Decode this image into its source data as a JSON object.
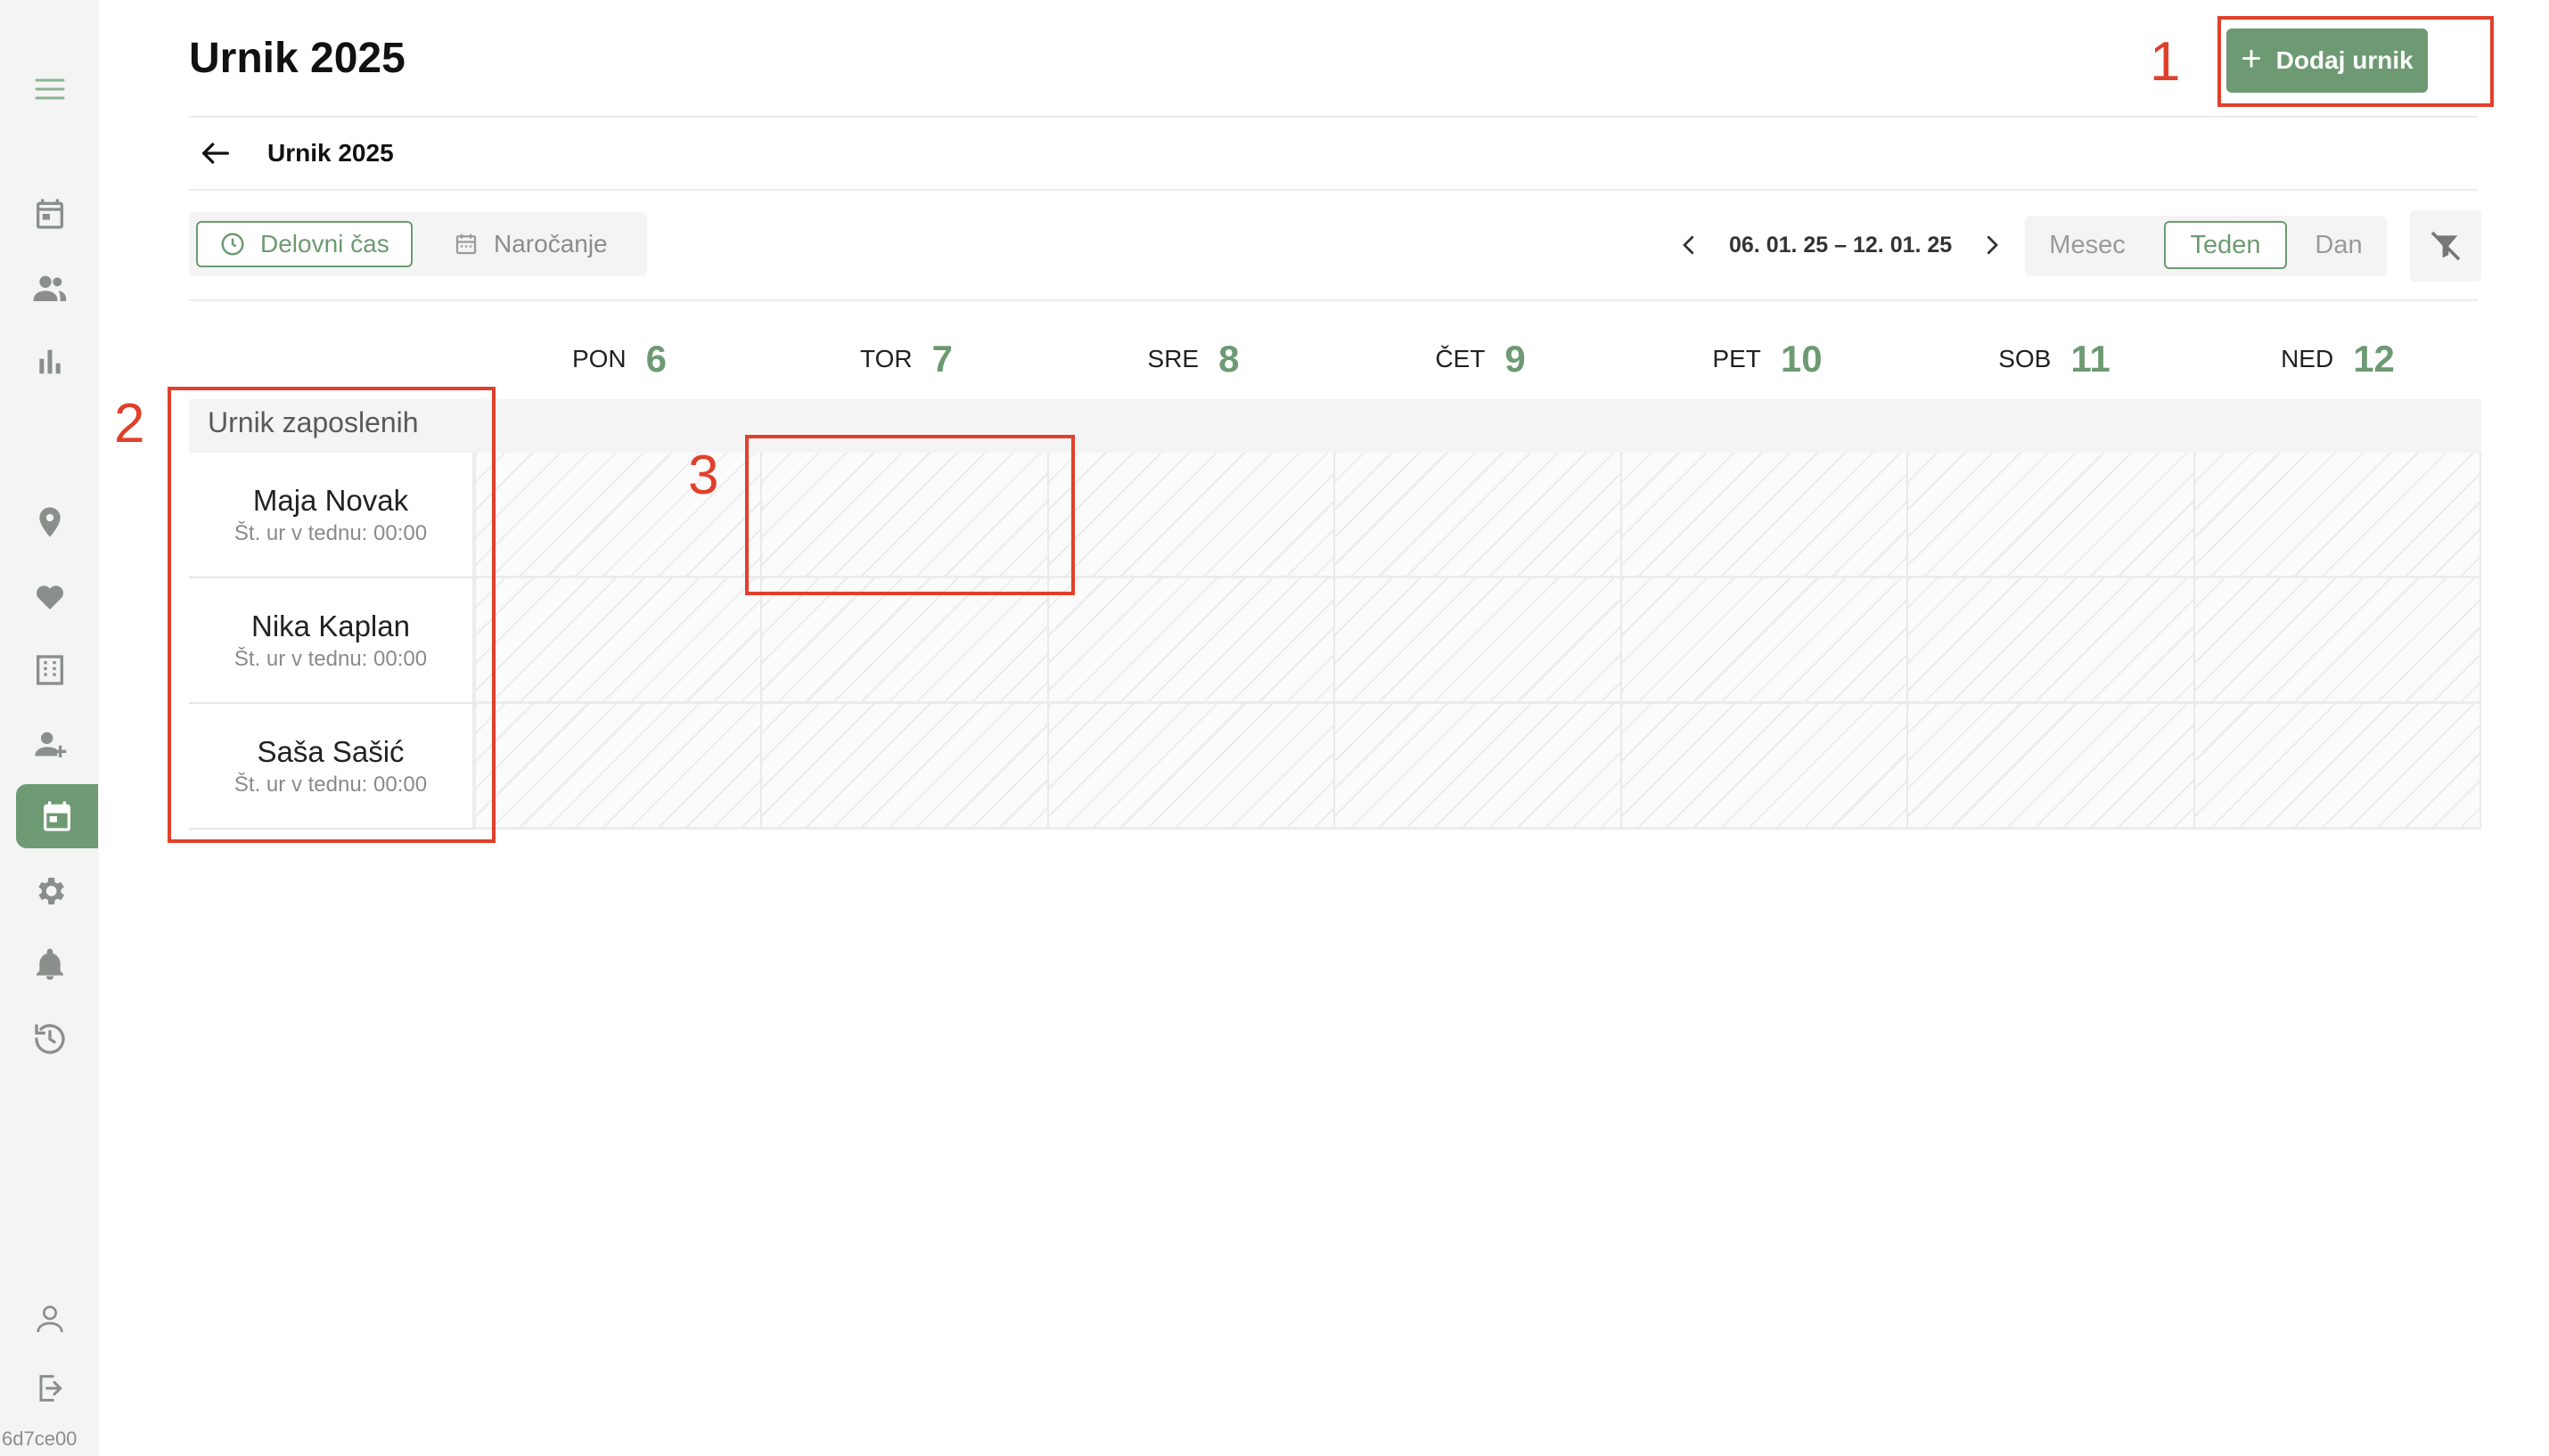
{
  "sidebar": {
    "icons": [
      {
        "name": "menu-icon"
      },
      {
        "name": "calendar-icon"
      },
      {
        "name": "users-icon"
      },
      {
        "name": "bar-chart-icon"
      },
      {
        "name": "location-icon"
      },
      {
        "name": "heart-hand-icon"
      },
      {
        "name": "building-icon"
      },
      {
        "name": "add-user-icon"
      },
      {
        "name": "schedule-icon",
        "active": true
      },
      {
        "name": "settings-icon"
      },
      {
        "name": "bell-icon"
      },
      {
        "name": "history-icon"
      },
      {
        "name": "profile-icon"
      },
      {
        "name": "logout-icon"
      }
    ],
    "footer_text": "6d7ce00"
  },
  "header": {
    "title": "Urnik 2025",
    "add_button_label": "Dodaj urnik"
  },
  "breadcrumb": {
    "label": "Urnik 2025"
  },
  "toolbar": {
    "left_tabs": [
      {
        "label": "Delovni čas",
        "active": true
      },
      {
        "label": "Naročanje",
        "active": false
      }
    ],
    "date_range": "06. 01. 25 – 12. 01. 25",
    "views": [
      {
        "label": "Mesec",
        "active": false
      },
      {
        "label": "Teden",
        "active": true
      },
      {
        "label": "Dan",
        "active": false
      }
    ]
  },
  "days": [
    {
      "name": "PON",
      "num": "6"
    },
    {
      "name": "TOR",
      "num": "7"
    },
    {
      "name": "SRE",
      "num": "8"
    },
    {
      "name": "ČET",
      "num": "9"
    },
    {
      "name": "PET",
      "num": "10"
    },
    {
      "name": "SOB",
      "num": "11"
    },
    {
      "name": "NED",
      "num": "12"
    }
  ],
  "schedule": {
    "section_title": "Urnik zaposlenih",
    "employees": [
      {
        "name": "Maja Novak",
        "hours": "Št. ur v tednu: 00:00"
      },
      {
        "name": "Nika Kaplan",
        "hours": "Št. ur v tednu: 00:00"
      },
      {
        "name": "Saša Sašić",
        "hours": "Št. ur v tednu: 00:00"
      }
    ]
  },
  "annotations": [
    "1",
    "2",
    "3"
  ],
  "colors": {
    "accent": "#6d9a72",
    "annotation": "#e0402b",
    "sidebar_bg": "#f3f4f3"
  }
}
